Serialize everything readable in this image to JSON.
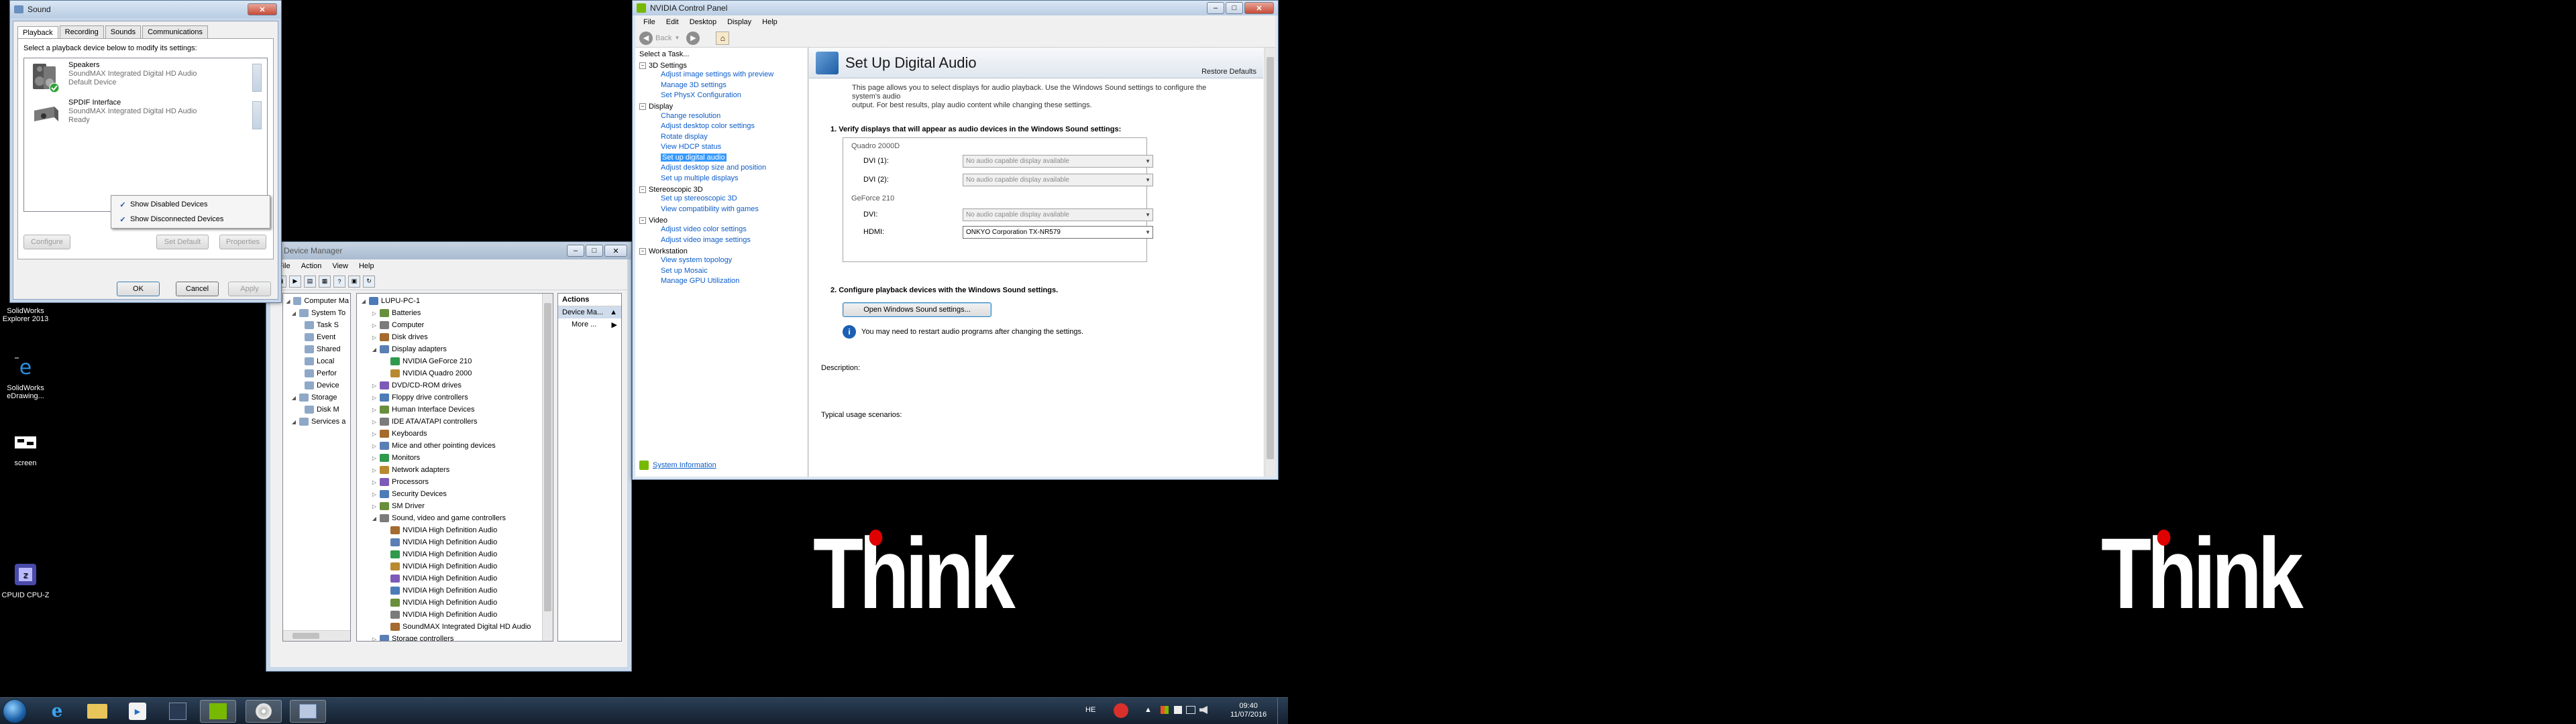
{
  "desktop": {
    "icons": [
      {
        "label_line1": "SolidWorks",
        "label_line2": "Explorer 2013"
      },
      {
        "label_line1": "SolidWorks",
        "label_line2": "eDrawing..."
      },
      {
        "label_line1": "screen",
        "label_line2": ""
      },
      {
        "label_line1": "CPUID CPU-Z",
        "label_line2": ""
      }
    ],
    "wallpaper_text": "Think"
  },
  "sound_dialog": {
    "title": "Sound",
    "tabs": [
      "Playback",
      "Recording",
      "Sounds",
      "Communications"
    ],
    "instruction": "Select a playback device below to modify its settings:",
    "devices": [
      {
        "name": "Speakers",
        "driver": "SoundMAX Integrated Digital HD Audio",
        "status": "Default Device"
      },
      {
        "name": "SPDIF Interface",
        "driver": "SoundMAX Integrated Digital HD Audio",
        "status": "Ready"
      }
    ],
    "context_menu": [
      {
        "label": "Show Disabled Devices",
        "checked": true
      },
      {
        "label": "Show Disconnected Devices",
        "checked": true
      }
    ],
    "buttons": {
      "configure": "Configure",
      "set_default": "Set Default",
      "properties": "Properties",
      "ok": "OK",
      "cancel": "Cancel",
      "apply": "Apply"
    }
  },
  "device_manager": {
    "title": "Device Manager",
    "menu": [
      "File",
      "Action",
      "View",
      "Help"
    ],
    "left_tree": [
      {
        "label": "Computer Ma",
        "indent": 0
      },
      {
        "label": "System To",
        "indent": 1
      },
      {
        "label": "Task S",
        "indent": 2
      },
      {
        "label": "Event",
        "indent": 2
      },
      {
        "label": "Shared",
        "indent": 2
      },
      {
        "label": "Local",
        "indent": 2
      },
      {
        "label": "Perfor",
        "indent": 2
      },
      {
        "label": "Device",
        "indent": 2
      },
      {
        "label": "Storage",
        "indent": 1
      },
      {
        "label": "Disk M",
        "indent": 2
      },
      {
        "label": "Services a",
        "indent": 1
      }
    ],
    "device_tree": [
      {
        "label": "LUPU-PC-1",
        "indent": 0,
        "exp": "◢"
      },
      {
        "label": "Batteries",
        "indent": 1,
        "exp": "▷"
      },
      {
        "label": "Computer",
        "indent": 1,
        "exp": "▷"
      },
      {
        "label": "Disk drives",
        "indent": 1,
        "exp": "▷"
      },
      {
        "label": "Display adapters",
        "indent": 1,
        "exp": "◢"
      },
      {
        "label": "NVIDIA GeForce 210",
        "indent": 2,
        "exp": ""
      },
      {
        "label": "NVIDIA Quadro 2000",
        "indent": 2,
        "exp": ""
      },
      {
        "label": "DVD/CD-ROM drives",
        "indent": 1,
        "exp": "▷"
      },
      {
        "label": "Floppy drive controllers",
        "indent": 1,
        "exp": "▷"
      },
      {
        "label": "Human Interface Devices",
        "indent": 1,
        "exp": "▷"
      },
      {
        "label": "IDE ATA/ATAPI controllers",
        "indent": 1,
        "exp": "▷"
      },
      {
        "label": "Keyboards",
        "indent": 1,
        "exp": "▷"
      },
      {
        "label": "Mice and other pointing devices",
        "indent": 1,
        "exp": "▷"
      },
      {
        "label": "Monitors",
        "indent": 1,
        "exp": "▷"
      },
      {
        "label": "Network adapters",
        "indent": 1,
        "exp": "▷"
      },
      {
        "label": "Processors",
        "indent": 1,
        "exp": "▷"
      },
      {
        "label": "Security Devices",
        "indent": 1,
        "exp": "▷"
      },
      {
        "label": "SM Driver",
        "indent": 1,
        "exp": "▷"
      },
      {
        "label": "Sound, video and game controllers",
        "indent": 1,
        "exp": "◢"
      },
      {
        "label": "NVIDIA High Definition Audio",
        "indent": 2,
        "exp": ""
      },
      {
        "label": "NVIDIA High Definition Audio",
        "indent": 2,
        "exp": ""
      },
      {
        "label": "NVIDIA High Definition Audio",
        "indent": 2,
        "exp": ""
      },
      {
        "label": "NVIDIA High Definition Audio",
        "indent": 2,
        "exp": ""
      },
      {
        "label": "NVIDIA High Definition Audio",
        "indent": 2,
        "exp": ""
      },
      {
        "label": "NVIDIA High Definition Audio",
        "indent": 2,
        "exp": ""
      },
      {
        "label": "NVIDIA High Definition Audio",
        "indent": 2,
        "exp": ""
      },
      {
        "label": "NVIDIA High Definition Audio",
        "indent": 2,
        "exp": ""
      },
      {
        "label": "SoundMAX Integrated Digital HD Audio",
        "indent": 2,
        "exp": ""
      },
      {
        "label": "Storage controllers",
        "indent": 1,
        "exp": "▷"
      }
    ],
    "actions": {
      "header": "Actions",
      "selected": "Device Ma...",
      "more": "More ..."
    }
  },
  "nvidia": {
    "title": "NVIDIA Control Panel",
    "menu": [
      "File",
      "Edit",
      "Desktop",
      "Display",
      "Help"
    ],
    "back": "Back",
    "select_task": "Select a Task...",
    "tree": [
      {
        "type": "cat",
        "label": "3D Settings"
      },
      {
        "type": "link",
        "label": "Adjust image settings with preview"
      },
      {
        "type": "link",
        "label": "Manage 3D settings"
      },
      {
        "type": "link",
        "label": "Set PhysX Configuration"
      },
      {
        "type": "cat",
        "label": "Display"
      },
      {
        "type": "link",
        "label": "Change resolution"
      },
      {
        "type": "link",
        "label": "Adjust desktop color settings"
      },
      {
        "type": "link",
        "label": "Rotate display"
      },
      {
        "type": "link",
        "label": "View HDCP status"
      },
      {
        "type": "sel",
        "label": "Set up digital audio"
      },
      {
        "type": "link",
        "label": "Adjust desktop size and position"
      },
      {
        "type": "link",
        "label": "Set up multiple displays"
      },
      {
        "type": "cat",
        "label": "Stereoscopic 3D"
      },
      {
        "type": "link",
        "label": "Set up stereoscopic 3D"
      },
      {
        "type": "link",
        "label": "View compatibility with games"
      },
      {
        "type": "cat",
        "label": "Video"
      },
      {
        "type": "link",
        "label": "Adjust video color settings"
      },
      {
        "type": "link",
        "label": "Adjust video image settings"
      },
      {
        "type": "cat",
        "label": "Workstation"
      },
      {
        "type": "link",
        "label": "View system topology"
      },
      {
        "type": "link",
        "label": "Set up Mosaic"
      },
      {
        "type": "link",
        "label": "Manage GPU Utilization"
      }
    ],
    "system_info": "System Information",
    "page_title": "Set Up Digital Audio",
    "restore_defaults": "Restore Defaults",
    "description_line1": "This page allows you to select displays for audio playback.  Use the Windows Sound settings to configure the system's audio",
    "description_line2": "output. For best results, play audio content while changing these settings.",
    "step1": "1. Verify displays that will appear as audio devices in the Windows Sound settings:",
    "gpu1": "Quadro 2000D",
    "gpu1_ports": [
      {
        "label": "DVI (1):",
        "value": "No audio capable display available",
        "active": false
      },
      {
        "label": "DVI (2):",
        "value": "No audio capable display available",
        "active": false
      }
    ],
    "gpu2": "GeForce 210",
    "gpu2_ports": [
      {
        "label": "DVI:",
        "value": "No audio capable display available",
        "active": false
      },
      {
        "label": "HDMI:",
        "value": "ONKYO Corporation TX-NR579",
        "active": true
      }
    ],
    "step2": "2. Configure playback devices with the Windows Sound settings.",
    "open_sound_button": "Open Windows Sound settings...",
    "restart_note": "You may need to restart audio programs after changing the settings.",
    "description_label": "Description:",
    "usage_label": "Typical usage scenarios:"
  },
  "taskbar": {
    "lang": "HE",
    "time": "09:40",
    "date": "11/07/2016"
  }
}
